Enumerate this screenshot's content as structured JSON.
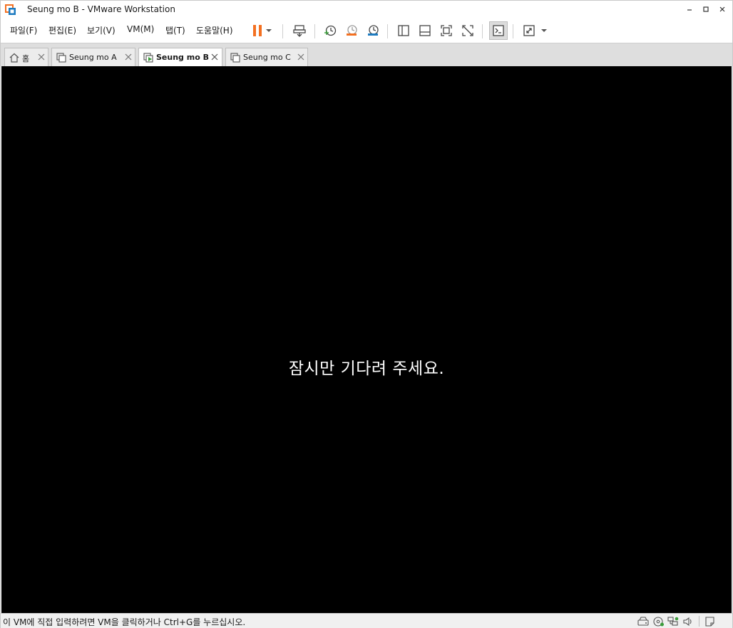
{
  "window": {
    "title": "Seung mo B - VMware Workstation",
    "accent_color": "#f37021",
    "min_icon": "minimize-icon",
    "max_icon": "maximize-icon",
    "close_icon": "close-icon"
  },
  "menu": {
    "items": [
      {
        "label": "파일(F)"
      },
      {
        "label": "편집(E)"
      },
      {
        "label": "보기(V)"
      },
      {
        "label": "VM(M)"
      },
      {
        "label": "탭(T)"
      },
      {
        "label": "도움말(H)"
      }
    ]
  },
  "toolbar": {
    "icons": [
      "pause-icon",
      "dropdown-arrow-icon",
      "send-ctrl-alt-del-icon",
      "snapshot-take-icon",
      "snapshot-revert-icon",
      "snapshot-manager-icon",
      "library-icon",
      "thumbnail-bar-icon",
      "full-screen-icon",
      "unity-icon",
      "console-view-icon",
      "stretch-guest-icon",
      "dropdown-arrow-icon"
    ]
  },
  "tabs": [
    {
      "label": "홈",
      "icon": "home-icon",
      "active": false
    },
    {
      "label": "Seung mo A",
      "icon": "vm-icon",
      "active": false
    },
    {
      "label": "Seung mo B",
      "icon": "vm-running-icon",
      "active": true
    },
    {
      "label": "Seung mo C",
      "icon": "vm-icon",
      "active": false
    }
  ],
  "vm": {
    "message": "잠시만 기다려 주세요.",
    "background": "#000000"
  },
  "status": {
    "text": "이 VM에 직접 입력하려면 VM을 클릭하거나 Ctrl+G를 누르십시오.",
    "icons": [
      "hard-disk-icon",
      "cd-dvd-icon",
      "network-adapter-icon",
      "sound-card-icon",
      "message-log-icon"
    ]
  }
}
